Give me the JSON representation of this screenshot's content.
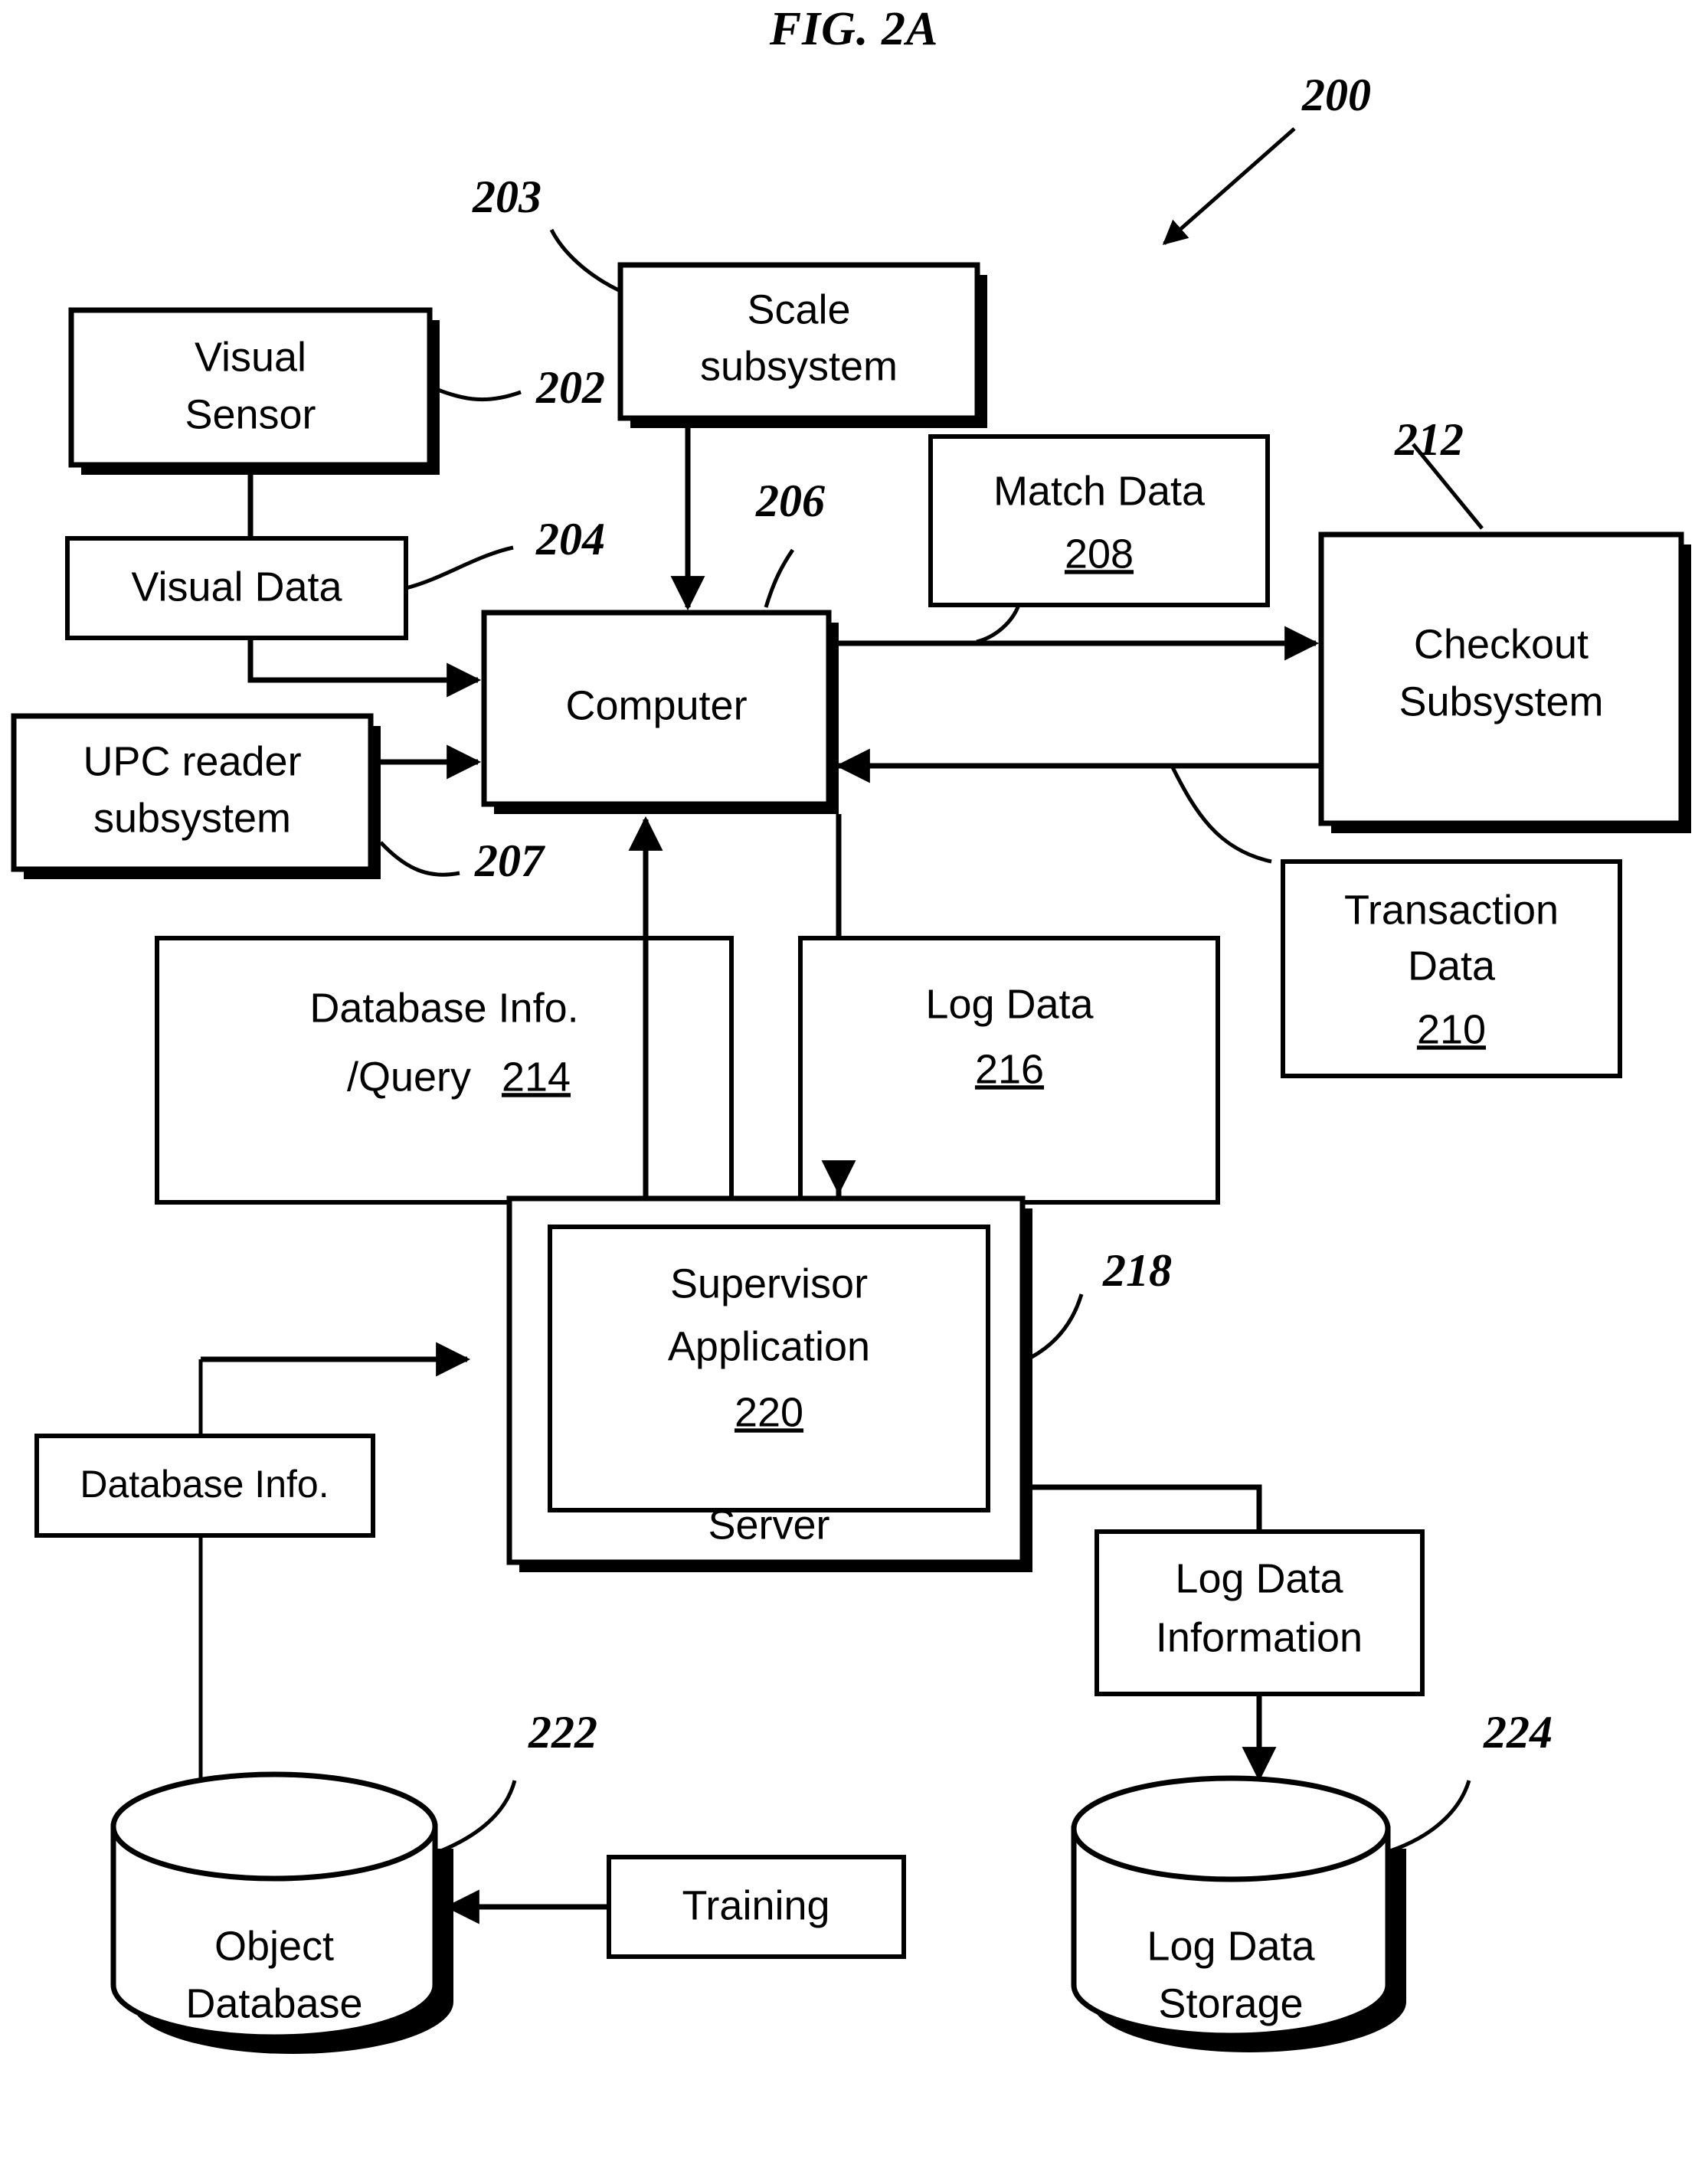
{
  "figure": {
    "title": "FIG. 2A",
    "system_ref": "200"
  },
  "nodes": {
    "visual_sensor": {
      "label_line1": "Visual",
      "label_line2": "Sensor",
      "ref": "202"
    },
    "scale_subsystem": {
      "label_line1": "Scale",
      "label_line2": "subsystem",
      "ref": "203"
    },
    "visual_data": {
      "label": "Visual Data",
      "ref": "204"
    },
    "upc_reader": {
      "label_line1": "UPC reader",
      "label_line2": "subsystem",
      "ref": "207"
    },
    "computer": {
      "label": "Computer",
      "ref": "206"
    },
    "match_data": {
      "label": "Match Data",
      "ref": "208"
    },
    "checkout_subsystem": {
      "label_line1": "Checkout",
      "label_line2": "Subsystem",
      "ref": "212"
    },
    "transaction_data": {
      "label_line1": "Transaction",
      "label_line2": "Data",
      "ref": "210"
    },
    "database_info_query": {
      "label_line1": "Database Info.",
      "label_line2": "/Query",
      "ref": "214"
    },
    "log_data": {
      "label": "Log Data",
      "ref": "216"
    },
    "server": {
      "label": "Server",
      "ref": "218"
    },
    "supervisor_application": {
      "label_line1": "Supervisor",
      "label_line2": "Application",
      "ref": "220"
    },
    "database_info": {
      "label": "Database Info."
    },
    "object_database": {
      "label_line1": "Object",
      "label_line2": "Database",
      "ref": "222"
    },
    "training": {
      "label": "Training"
    },
    "log_data_information": {
      "label_line1": "Log Data",
      "label_line2": "Information"
    },
    "log_data_storage": {
      "label_line1": "Log Data",
      "label_line2": "Storage",
      "ref": "224"
    }
  },
  "colors": {
    "ink": "#000000",
    "paper": "#ffffff"
  }
}
